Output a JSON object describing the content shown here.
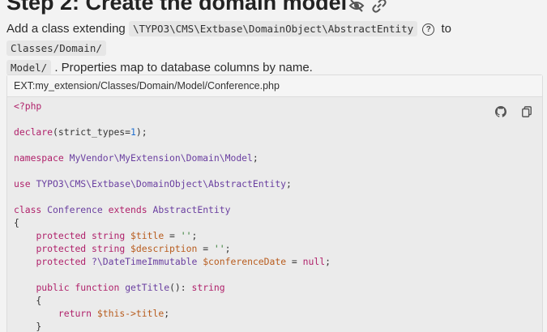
{
  "heading": {
    "title": "Step 2: Create the domain model"
  },
  "intro": {
    "text_before": "Add a class extending",
    "class_name": "\\TYPO3\\CMS\\Extbase\\DomainObject\\AbstractEntity",
    "text_to": "to",
    "path_part1": "Classes/Domain/",
    "path_part2": "Model/",
    "text_after": ". Properties map to database columns by name."
  },
  "file": {
    "path": "EXT:my_extension/Classes/Domain/Model/Conference.php",
    "actions": [
      "github-icon",
      "copy-icon"
    ]
  },
  "code": [
    "<?php",
    "",
    "declare(strict_types=1);",
    "",
    "namespace MyVendor\\MyExtension\\Domain\\Model;",
    "",
    "use TYPO3\\CMS\\Extbase\\DomainObject\\AbstractEntity;",
    "",
    "class Conference extends AbstractEntity",
    "{",
    "    protected string $title = '';",
    "    protected string $description = '';",
    "    protected ?\\DateTimeImmutable $conferenceDate = null;",
    "",
    "    public function getTitle(): string",
    "    {",
    "        return $this->title;",
    "    }"
  ]
}
